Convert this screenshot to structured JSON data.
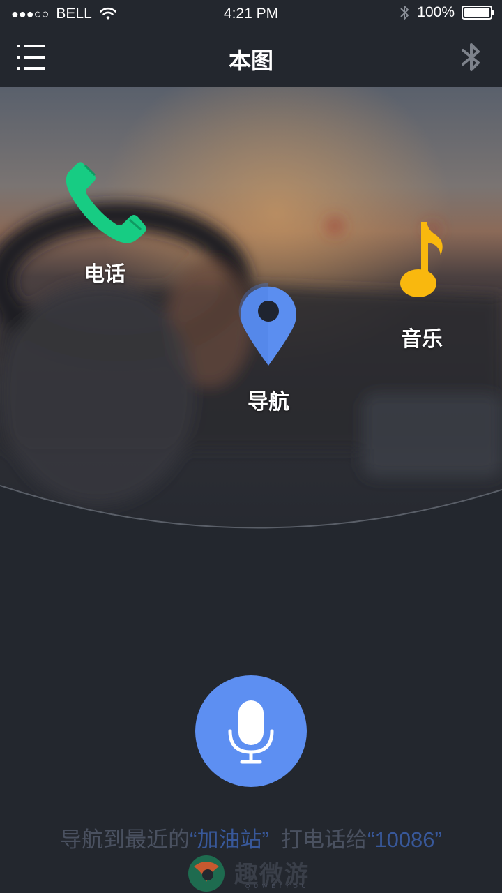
{
  "status_bar": {
    "carrier": "BELL",
    "time": "4:21 PM",
    "battery": "100%",
    "icons": [
      "signal-dots",
      "wifi-icon",
      "bluetooth-icon",
      "battery-icon"
    ]
  },
  "header": {
    "title": "本图",
    "left_icon": "menu-list-icon",
    "right_icon": "bluetooth-icon"
  },
  "shortcuts": [
    {
      "label": "电话",
      "icon": "phone-icon",
      "color": "#17cc83"
    },
    {
      "label": "导航",
      "icon": "map-pin-icon",
      "color": "#5b8ef0"
    },
    {
      "label": "音乐",
      "icon": "music-note-icon",
      "color": "#f9b80e"
    }
  ],
  "voice": {
    "icon": "microphone-icon",
    "button_color": "#5d8ff2"
  },
  "hint": {
    "part1": "导航到最近的",
    "quote1": "“加油站”",
    "part2": "  打电话给",
    "quote2": "“10086”"
  },
  "watermark": {
    "text": "趣微游",
    "sub": "QUWEIYOU"
  },
  "colors": {
    "background": "#23272e",
    "accent": "#5d8ff2"
  }
}
